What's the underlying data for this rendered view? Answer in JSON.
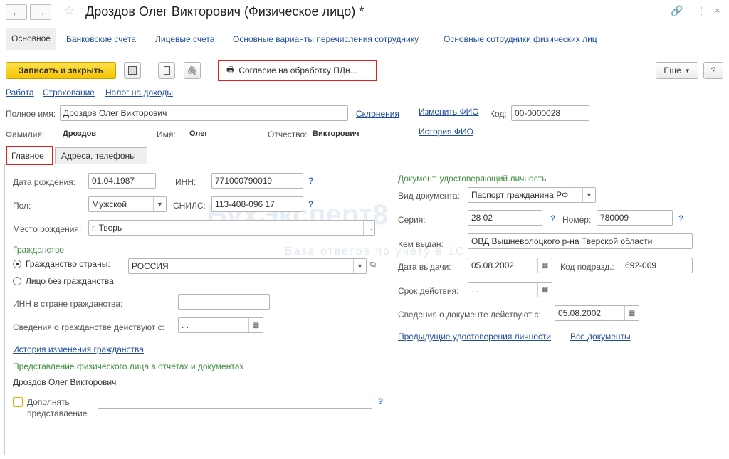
{
  "window": {
    "title": "Дроздов Олег Викторович (Физическое лицо) *"
  },
  "top_tabs": [
    {
      "label": "Основное"
    },
    {
      "label": "Банковские счета"
    },
    {
      "label": "Лицевые счета"
    },
    {
      "label": "Основные варианты перечисления сотруднику"
    },
    {
      "label": "Основные сотрудники физических лиц"
    }
  ],
  "toolbar": {
    "save_close": "Записать и закрыть",
    "consent": "Согласие на обработку ПДн...",
    "more": "Еще",
    "help": "?"
  },
  "sublinks": [
    "Работа",
    "Страхование",
    "Налог на доходы"
  ],
  "person": {
    "full_name_label": "Полное имя:",
    "full_name": "Дроздов Олег Викторович",
    "declensions": "Склонения",
    "change_fio": "Изменить ФИО",
    "code_label": "Код:",
    "code": "00-0000028",
    "surname_label": "Фамилия:",
    "surname": "Дроздов",
    "name_label": "Имя:",
    "name": "Олег",
    "patronymic_label": "Отчество:",
    "patronymic": "Викторович",
    "fio_history": "История ФИО"
  },
  "tabs": [
    {
      "label": "Главное"
    },
    {
      "label": "Адреса, телефоны"
    }
  ],
  "main": {
    "birth_label": "Дата рождения:",
    "birth": "01.04.1987",
    "inn_label": "ИНН:",
    "inn": "771000790019",
    "gender_label": "Пол:",
    "gender": "Мужской",
    "snils_label": "СНИЛС:",
    "snils": "113-408-096 17",
    "birthplace_label": "Место рождения:",
    "birthplace": "г. Тверь",
    "citizenship_header": "Гражданство",
    "citizen_country_label": "Гражданство страны:",
    "country": "РОССИЯ",
    "stateless_label": "Лицо без гражданства",
    "foreign_inn_label": "ИНН в стране гражданства:",
    "citizenship_since_label": "Сведения о гражданстве действуют с:",
    "citizenship_since": " .  .",
    "citizenship_history": "История изменения гражданства",
    "representation_header": "Представление физического лица в отчетах и документах",
    "representation": "Дроздов Олег Викторович",
    "supplement_label1": "Дополнять",
    "supplement_label2": "представление",
    "help": "?"
  },
  "doc": {
    "header": "Документ, удостоверяющий личность",
    "type_label": "Вид документа:",
    "type": "Паспорт гражданина РФ",
    "series_label": "Серия:",
    "series": "28 02",
    "number_label": "Номер:",
    "number": "780009",
    "issued_by_label": "Кем выдан:",
    "issued_by": "ОВД Вышневолоцкого р-на Тверской области",
    "issue_date_label": "Дата выдачи:",
    "issue_date": "05.08.2002",
    "dept_code_label": "Код подразд.:",
    "dept_code": "692-009",
    "validity_label": "Срок действия:",
    "validity": " .  .",
    "valid_from_label": "Сведения о документе действуют с:",
    "valid_from": "05.08.2002",
    "prev_docs": "Предыдущие удостоверения личности",
    "all_docs": "Все документы"
  },
  "watermark": {
    "line1": "БухЭксперт8",
    "line2": "База ответов по учету в 1С"
  }
}
